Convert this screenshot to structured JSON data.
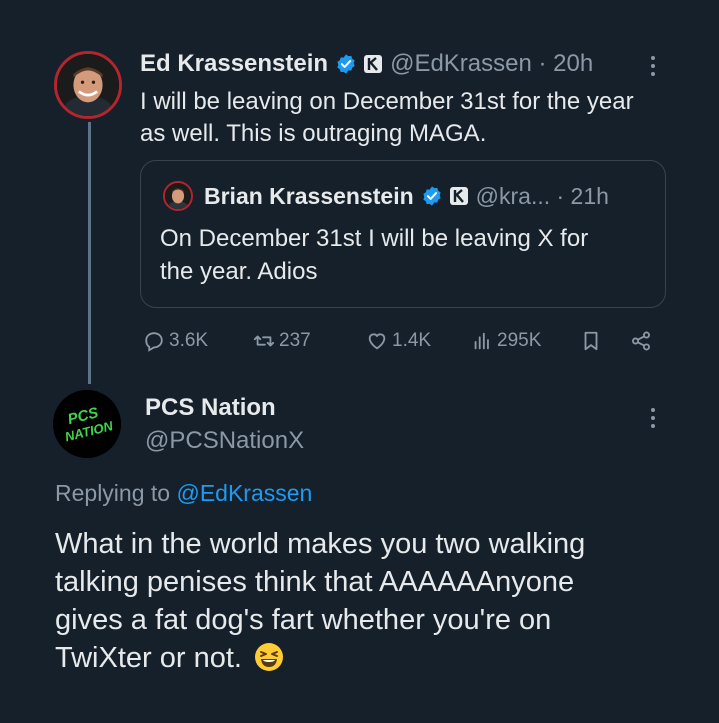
{
  "tweet": {
    "author_name": "Ed Krassenstein",
    "author_handle": "@EdKrassen · 20h",
    "text_line1": "I will be leaving on December 31st for the year",
    "text_line2": "as well.  This is outraging MAGA.",
    "quote": {
      "author_name": "Brian Krassenstein",
      "author_handle": "@kra... · 21h",
      "text_line1": "On December 31st I will be leaving X for",
      "text_line2": "the year. Adios"
    },
    "actions": {
      "replies": "3.6K",
      "reposts": "237",
      "likes": "1.4K",
      "views": "295K"
    }
  },
  "reply": {
    "author_name": "PCS Nation",
    "author_handle": "@PCSNationX",
    "avatar_text_line1": "PCS",
    "avatar_text_line2": "NATION",
    "replying_label": "Replying to ",
    "replying_handle": "@EdKrassen",
    "text_line1": "What in the world makes you two walking",
    "text_line2": "talking penises think that AAAAAAnyone",
    "text_line3": "gives a fat dog's fart whether you're on",
    "text_line4": "TwiXter or not."
  },
  "colors": {
    "background": "#15202b",
    "text": "#e7e9ea",
    "secondary": "#8b98a5",
    "link": "#1d9bf0",
    "border": "#38444d"
  },
  "icons": [
    "verified-badge-icon",
    "affiliate-k-icon",
    "more-icon",
    "reply-icon",
    "repost-icon",
    "like-icon",
    "views-icon",
    "bookmark-icon",
    "share-icon",
    "grinning-squinting-emoji"
  ]
}
